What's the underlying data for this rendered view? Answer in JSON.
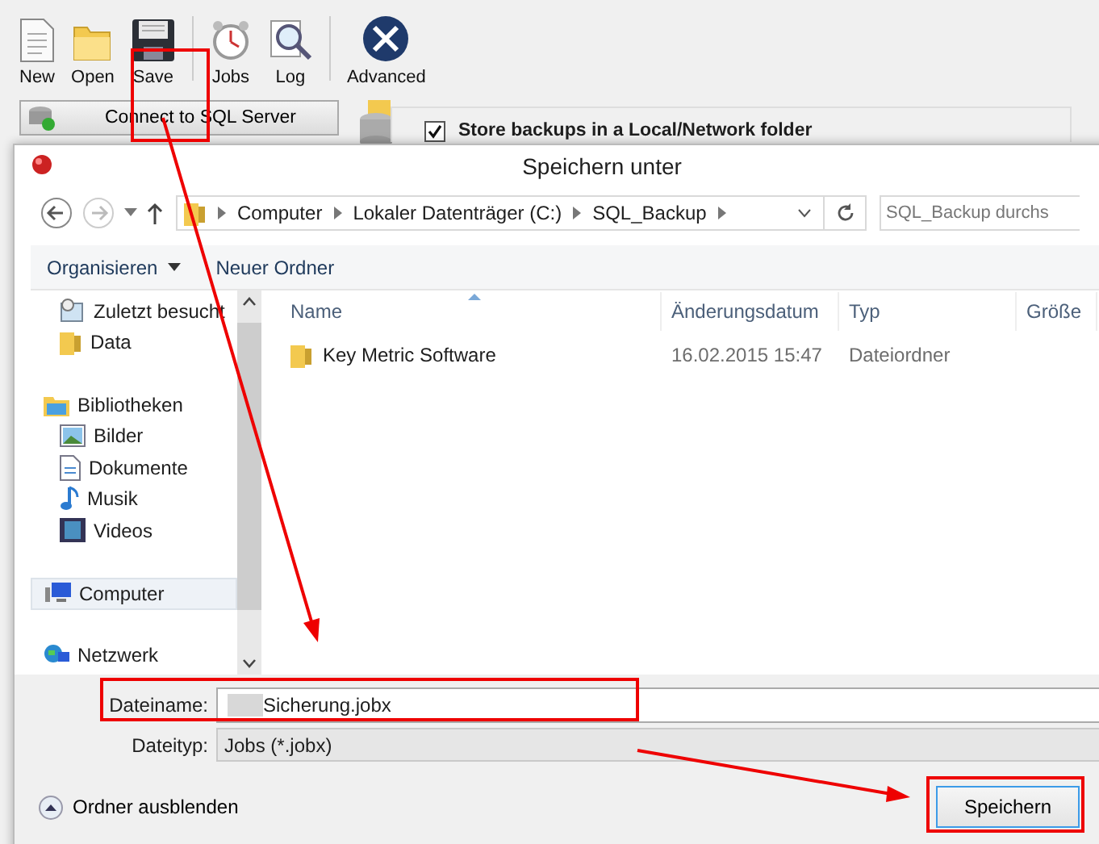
{
  "app_toolbar": [
    {
      "label": "New",
      "kind": "new"
    },
    {
      "label": "Open",
      "kind": "open"
    },
    {
      "label": "Save",
      "kind": "save"
    },
    {
      "label": "Jobs",
      "kind": "jobs"
    },
    {
      "label": "Log",
      "kind": "log"
    },
    {
      "label": "Advanced",
      "kind": "advanced"
    }
  ],
  "connect_button": "Connect to SQL Server",
  "store_option": {
    "label": "Store backups in a Local/Network folder",
    "checked": true
  },
  "dialog": {
    "title": "Speichern unter",
    "breadcrumb": [
      "Computer",
      "Lokaler Datenträger (C:)",
      "SQL_Backup"
    ],
    "search": {
      "placeholder": "SQL_Backup durchs"
    },
    "commands": [
      {
        "label": "Organisieren",
        "dropdown": true
      },
      {
        "label": "Neuer Ordner",
        "dropdown": false
      }
    ],
    "nav_tree": [
      {
        "children": [
          {
            "label": "Zuletzt besucht",
            "kind": "recent",
            "selected": false
          },
          {
            "label": "Data",
            "kind": "folder",
            "selected": false
          }
        ]
      },
      {
        "label": "Bibliotheken",
        "kind": "library",
        "selected": false,
        "children": [
          {
            "label": "Bilder",
            "kind": "pictures",
            "selected": false
          },
          {
            "label": "Dokumente",
            "kind": "documents",
            "selected": false
          },
          {
            "label": "Musik",
            "kind": "music",
            "selected": false
          },
          {
            "label": "Videos",
            "kind": "videos",
            "selected": false
          }
        ]
      },
      {
        "label": "Computer",
        "kind": "computer",
        "selected": true
      },
      {
        "label": "Netzwerk",
        "kind": "network",
        "selected": false
      }
    ],
    "columns": [
      "Name",
      "Änderungsdatum",
      "Typ",
      "Größe"
    ],
    "rows": [
      {
        "name": "Key Metric Software",
        "date": "16.02.2015 15:47",
        "type": "Dateiordner"
      }
    ],
    "filename": {
      "label": "Dateiname:",
      "value": "Sicherung.jobx"
    },
    "filetype": {
      "label": "Dateityp:",
      "value": "Jobs  (*.jobx)"
    },
    "hide_folders": "Ordner ausblenden",
    "save_button": "Speichern"
  }
}
